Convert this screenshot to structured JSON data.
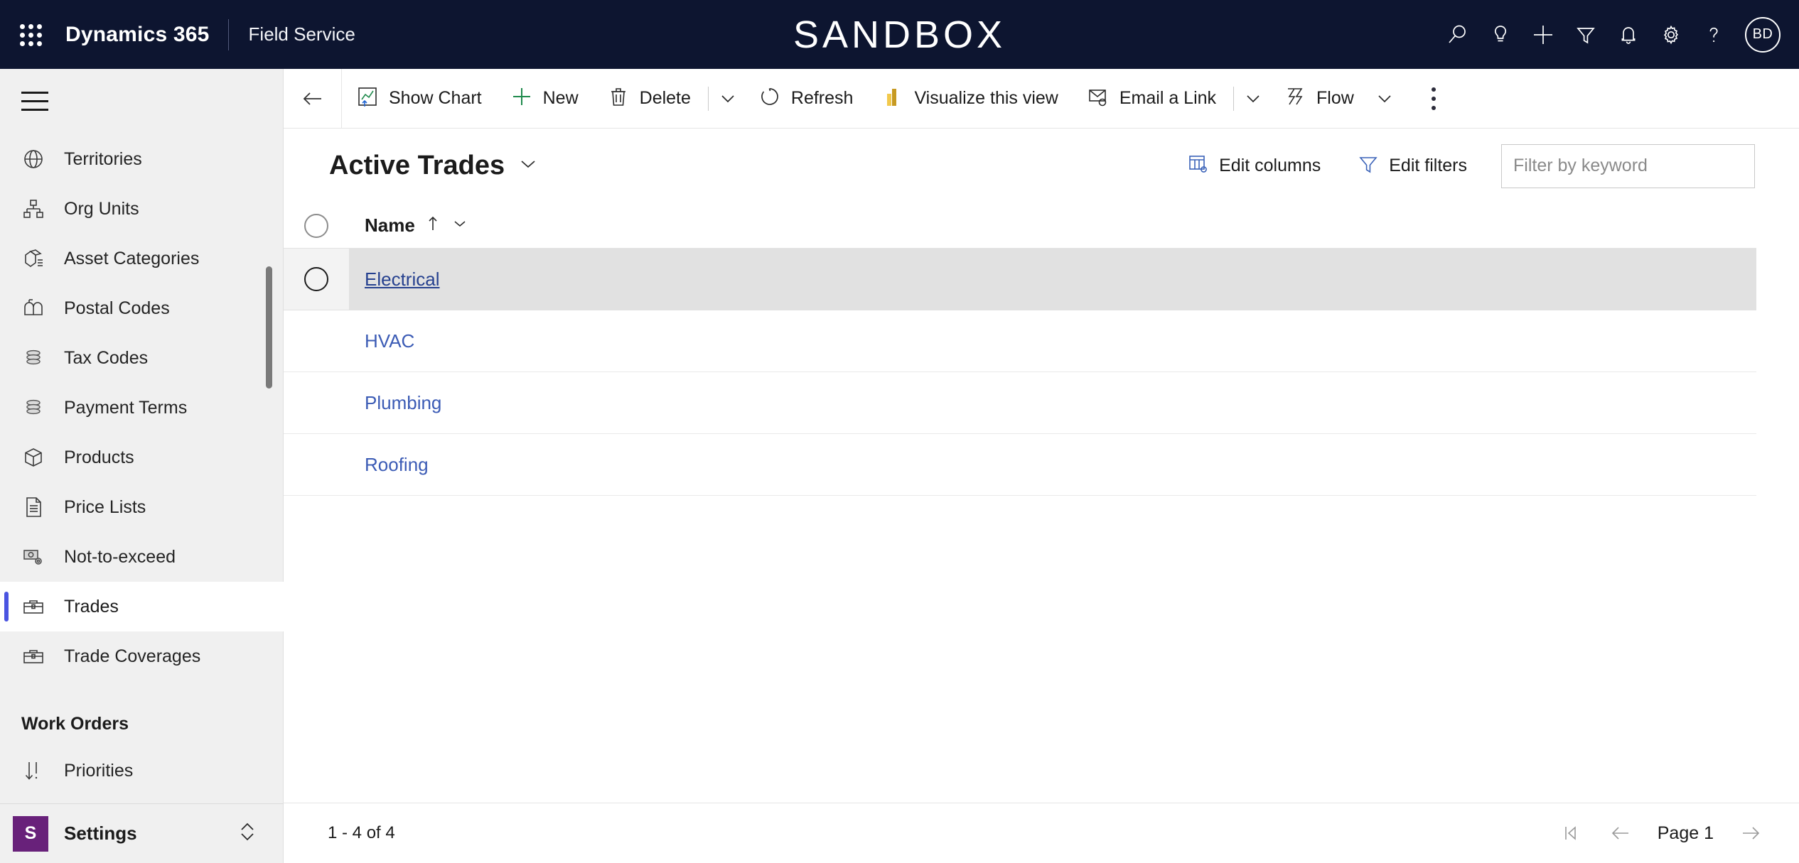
{
  "app_bar": {
    "waffle_icon": "app-launcher-icon",
    "brand": "Dynamics 365",
    "module": "Field Service",
    "environment_banner": "SANDBOX",
    "actions": [
      {
        "name": "search-icon",
        "label": "Search"
      },
      {
        "name": "lightbulb-icon",
        "label": "Assistant"
      },
      {
        "name": "plus-icon",
        "label": "Quick create"
      },
      {
        "name": "filter-icon",
        "label": "Filter"
      },
      {
        "name": "bell-icon",
        "label": "Notifications"
      },
      {
        "name": "gear-icon",
        "label": "Settings"
      },
      {
        "name": "help-icon",
        "label": "Help"
      }
    ],
    "avatar_initials": "BD"
  },
  "sidebar": {
    "hamburger_label": "Expand/collapse site map",
    "items": [
      {
        "label": "Territories",
        "icon": "globe-icon",
        "selected": false
      },
      {
        "label": "Org Units",
        "icon": "org-chart-icon",
        "selected": false
      },
      {
        "label": "Asset Categories",
        "icon": "asset-category-icon",
        "selected": false
      },
      {
        "label": "Postal Codes",
        "icon": "mailbox-icon",
        "selected": false
      },
      {
        "label": "Tax Codes",
        "icon": "stacked-disks-icon",
        "selected": false
      },
      {
        "label": "Payment Terms",
        "icon": "stacked-disks-icon",
        "selected": false
      },
      {
        "label": "Products",
        "icon": "box-icon",
        "selected": false
      },
      {
        "label": "Price Lists",
        "icon": "document-list-icon",
        "selected": false
      },
      {
        "label": "Not-to-exceed",
        "icon": "money-gear-icon",
        "selected": false
      },
      {
        "label": "Trades",
        "icon": "toolbox-icon",
        "selected": true
      },
      {
        "label": "Trade Coverages",
        "icon": "toolbox-icon",
        "selected": false
      }
    ],
    "group_title": "Work Orders",
    "group_items": [
      {
        "label": "Priorities",
        "icon": "sort-priority-icon",
        "selected": false
      }
    ],
    "footer": {
      "tile_initial": "S",
      "label": "Settings",
      "chevrons_icon": "chevron-up-down-icon"
    }
  },
  "command_bar": {
    "back_icon": "back-arrow-icon",
    "commands": [
      {
        "label": "Show Chart",
        "icon": "show-chart-icon"
      },
      {
        "label": "New",
        "icon": "plus-icon"
      },
      {
        "label": "Delete",
        "icon": "trash-icon",
        "has_caret": true
      },
      {
        "label": "Refresh",
        "icon": "refresh-icon"
      },
      {
        "label": "Visualize this view",
        "icon": "visualize-icon"
      },
      {
        "label": "Email a Link",
        "icon": "email-link-icon",
        "has_caret": true
      },
      {
        "label": "Flow",
        "icon": "flow-icon",
        "has_caret": true
      }
    ],
    "overflow_icon": "more-vertical-icon"
  },
  "view_header": {
    "title": "Active Trades",
    "chevron_icon": "chevron-down-icon",
    "edit_columns": {
      "label": "Edit columns",
      "icon": "edit-columns-icon"
    },
    "edit_filters": {
      "label": "Edit filters",
      "icon": "filter-icon"
    },
    "search": {
      "placeholder": "Filter by keyword",
      "value": ""
    }
  },
  "grid": {
    "columns": [
      {
        "label": "Name",
        "sort": "ascending",
        "sort_icon": "arrow-up-icon",
        "menu_icon": "chevron-down-icon"
      }
    ],
    "select_all_icon": "select-all-circle-icon",
    "rows": [
      {
        "name": "Electrical",
        "hovered": true
      },
      {
        "name": "HVAC",
        "hovered": false
      },
      {
        "name": "Plumbing",
        "hovered": false
      },
      {
        "name": "Roofing",
        "hovered": false
      }
    ]
  },
  "footer": {
    "record_count": "1 - 4 of 4",
    "first_page_icon": "first-page-icon",
    "previous_page_icon": "previous-page-icon",
    "page_label": "Page 1",
    "next_page_icon": "next-page-icon"
  },
  "colors": {
    "app_bar_bg": "#0d1530",
    "sidebar_bg": "#f0f0f0",
    "accent_blue": "#4a54e1",
    "link_blue": "#3b5bb5",
    "link_blue_hover": "#26418f",
    "settings_purple": "#68217a",
    "row_hover_bg": "#e1e1e1"
  }
}
